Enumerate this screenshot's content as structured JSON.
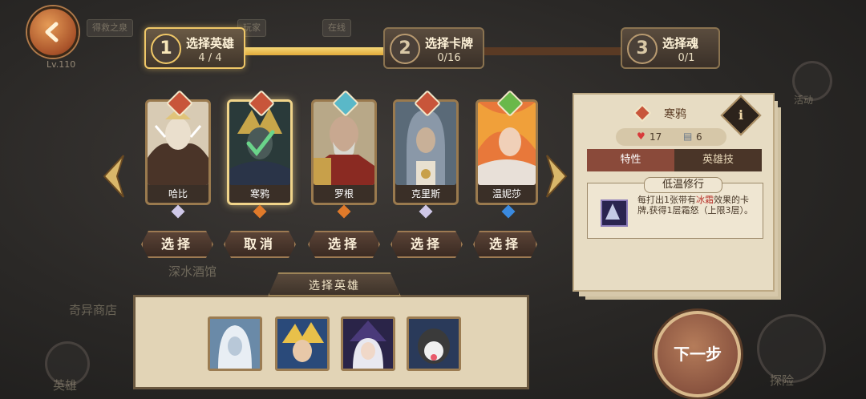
{
  "header": {
    "level": "Lv.110",
    "steps": [
      {
        "num": "1",
        "title": "选择英雄",
        "progress": "4 / 4",
        "active": true
      },
      {
        "num": "2",
        "title": "选择卡牌",
        "progress": "0/16",
        "active": false
      },
      {
        "num": "3",
        "title": "选择魂",
        "progress": "0/1",
        "active": false
      }
    ],
    "step1_fill": 1.0
  },
  "background_text": {
    "tavern": "深水酒馆",
    "shop": "奇异商店",
    "heroes": "英雄",
    "explore": "探险",
    "activity": "活动"
  },
  "heroes": [
    {
      "name": "哈比",
      "button": "选择",
      "role_color": "#c8553a",
      "gem_color": "#cfc8e8",
      "selected": false
    },
    {
      "name": "寒鸦",
      "button": "取消",
      "role_color": "#c8553a",
      "gem_color": "#e07a2a",
      "selected": true
    },
    {
      "name": "罗根",
      "button": "选择",
      "role_color": "#5ab8c8",
      "gem_color": "#e07a2a",
      "selected": false
    },
    {
      "name": "克里斯",
      "button": "选择",
      "role_color": "#c8553a",
      "gem_color": "#cfc8e8",
      "selected": false
    },
    {
      "name": "温妮莎",
      "button": "选择",
      "role_color": "#6ab84a",
      "gem_color": "#3a8ae0",
      "selected": false
    }
  ],
  "info_panel": {
    "hero_name": "寒鸦",
    "info_icon": "i",
    "hp": "17",
    "cost": "6",
    "tabs": [
      "特性",
      "英雄技"
    ],
    "active_tab": "特性",
    "trait": {
      "name": "低温修行",
      "desc_before": "每打出1张带有",
      "keyword": "冰霜",
      "desc_after": "效果的卡牌,获得1层霜怒（上限3层）。"
    }
  },
  "team": {
    "title": "选择英雄",
    "slot_count": 4
  },
  "next_button": "下一步"
}
